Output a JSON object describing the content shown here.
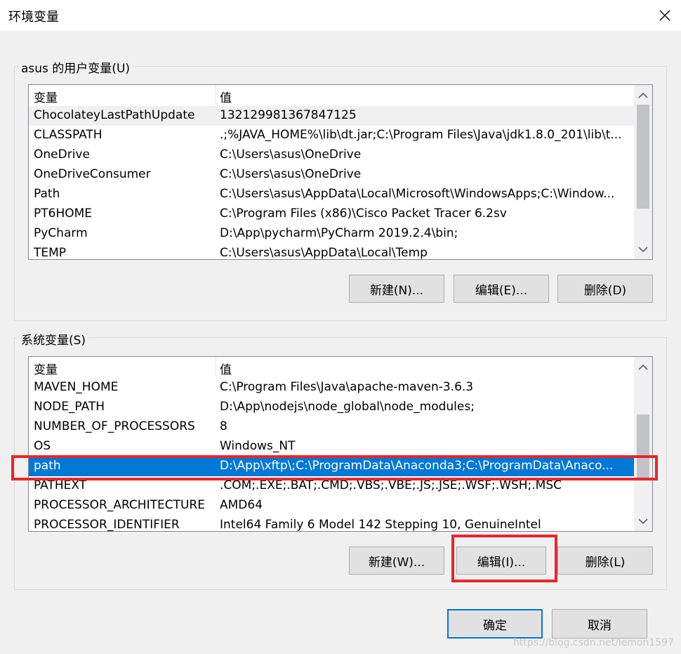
{
  "window": {
    "title": "环境变量"
  },
  "user_vars": {
    "group_label": "asus 的用户变量(U)",
    "header": {
      "name": "变量",
      "value": "值"
    },
    "rows": [
      {
        "name": "ChocolateyLastPathUpdate",
        "value": "132129981367847125"
      },
      {
        "name": "CLASSPATH",
        "value": ".;%JAVA_HOME%\\lib\\dt.jar;C:\\Program Files\\Java\\jdk1.8.0_201\\lib\\t..."
      },
      {
        "name": "OneDrive",
        "value": "C:\\Users\\asus\\OneDrive"
      },
      {
        "name": "OneDriveConsumer",
        "value": "C:\\Users\\asus\\OneDrive"
      },
      {
        "name": "Path",
        "value": "C:\\Users\\asus\\AppData\\Local\\Microsoft\\WindowsApps;C:\\Window..."
      },
      {
        "name": "PT6HOME",
        "value": "C:\\Program Files (x86)\\Cisco Packet Tracer 6.2sv"
      },
      {
        "name": "PyCharm",
        "value": "D:\\App\\pycharm\\PyCharm 2019.2.4\\bin;"
      },
      {
        "name": "TEMP",
        "value": "C:\\Users\\asus\\AppData\\Local\\Temp"
      }
    ],
    "buttons": {
      "new": "新建(N)...",
      "edit": "编辑(E)...",
      "delete": "删除(D)"
    }
  },
  "system_vars": {
    "group_label": "系统变量(S)",
    "header": {
      "name": "变量",
      "value": "值"
    },
    "rows": [
      {
        "name": "MAVEN_HOME",
        "value": "C:\\Program Files\\Java\\apache-maven-3.6.3"
      },
      {
        "name": "NODE_PATH",
        "value": "D:\\App\\nodejs\\node_global\\node_modules;"
      },
      {
        "name": "NUMBER_OF_PROCESSORS",
        "value": "8"
      },
      {
        "name": "OS",
        "value": "Windows_NT"
      },
      {
        "name": "path",
        "value": "D:\\App\\xftp\\;C:\\ProgramData\\Anaconda3;C:\\ProgramData\\Anaco..."
      },
      {
        "name": "PATHEXT",
        "value": ".COM;.EXE;.BAT;.CMD;.VBS;.VBE;.JS;.JSE;.WSF;.WSH;.MSC"
      },
      {
        "name": "PROCESSOR_ARCHITECTURE",
        "value": "AMD64"
      },
      {
        "name": "PROCESSOR_IDENTIFIER",
        "value": "Intel64 Family 6 Model 142 Stepping 10, GenuineIntel"
      }
    ],
    "buttons": {
      "new": "新建(W)...",
      "edit": "编辑(I)...",
      "delete": "删除(L)"
    }
  },
  "dialog_buttons": {
    "ok": "确定",
    "cancel": "取消"
  },
  "watermark": "https://blog.csdn.net/lemon1597",
  "colors": {
    "selection": "#0078d7",
    "highlight_box": "#e8262c"
  }
}
